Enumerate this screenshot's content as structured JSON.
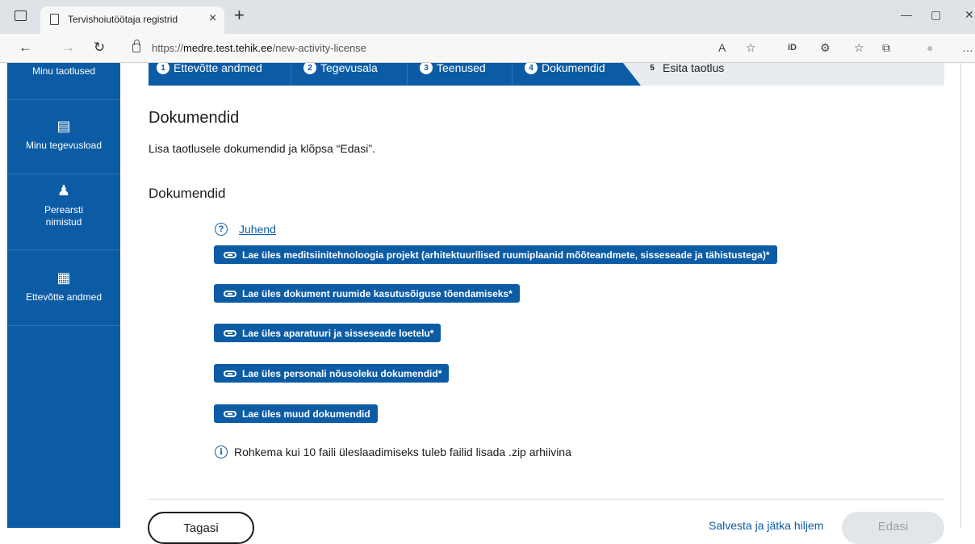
{
  "browser": {
    "tab_title": "Tervishoiutöötaja registrid",
    "tab_close": "×",
    "new_tab": "+",
    "url_prefix": "https://",
    "url_host": "medre.test.tehik.ee",
    "url_path": "/new-activity-license",
    "controls": {
      "minimize": "—",
      "maximize": "▢",
      "close": "✕"
    },
    "nav": {
      "back": "←",
      "forward": "→",
      "reload": "↻"
    },
    "toolbar_icons": [
      "read-aloud-icon",
      "favorite-add-icon",
      "id-extension-icon",
      "extensions-icon",
      "favorites-icon",
      "collections-icon",
      "profile-icon",
      "more-icon"
    ],
    "toolbar_glyphs": [
      "A",
      "☆",
      "iD",
      "⚙",
      "☆",
      "⧉",
      "●",
      "…"
    ]
  },
  "sidebar": {
    "items": [
      {
        "label": "Minu taotlused",
        "icon": ""
      },
      {
        "label": "Minu tegevusload",
        "icon": "▤"
      },
      {
        "label": "Perearsti nimistud",
        "icon": "♟"
      },
      {
        "label": "Ettevõtte andmed",
        "icon": "▦"
      }
    ]
  },
  "stepper": {
    "steps": [
      {
        "num": "1",
        "label": "Ettevõtte andmed",
        "state": "done"
      },
      {
        "num": "2",
        "label": "Tegevusala",
        "state": "done"
      },
      {
        "num": "3",
        "label": "Teenused",
        "state": "done"
      },
      {
        "num": "4",
        "label": "Dokumendid",
        "state": "active"
      },
      {
        "num": "5",
        "label": "Esita taotlus",
        "state": "pending"
      }
    ]
  },
  "main": {
    "title": "Dokumendid",
    "description": "Lisa taotlusele dokumendid ja klõpsa “Edasi”.",
    "section_title": "Dokumendid",
    "guide_icon": "?",
    "guide_link": "Juhend",
    "uploads": [
      "Lae üles meditsiinitehnoloogia projekt (arhitektuurilised ruumiplaanid mõõteandmete, sisseseade ja tähistustega)*",
      "Lae üles dokument ruumide kasutusõiguse tõendamiseks*",
      "Lae üles aparatuuri ja sisseseade loetelu*",
      "Lae üles personali nõusoleku dokumendid*",
      "Lae üles muud dokumendid"
    ],
    "info_icon": "i",
    "info_text": "Rohkema kui 10 faili üleslaadimiseks tuleb failid lisada .zip arhiivina"
  },
  "footer": {
    "back": "Tagasi",
    "save": "Salvesta ja jätka hiljem",
    "next": "Edasi"
  },
  "colors": {
    "primary": "#0c5ca5",
    "stepper_bg": "#e9ecef",
    "disabled_bg": "#e3e6e9"
  }
}
